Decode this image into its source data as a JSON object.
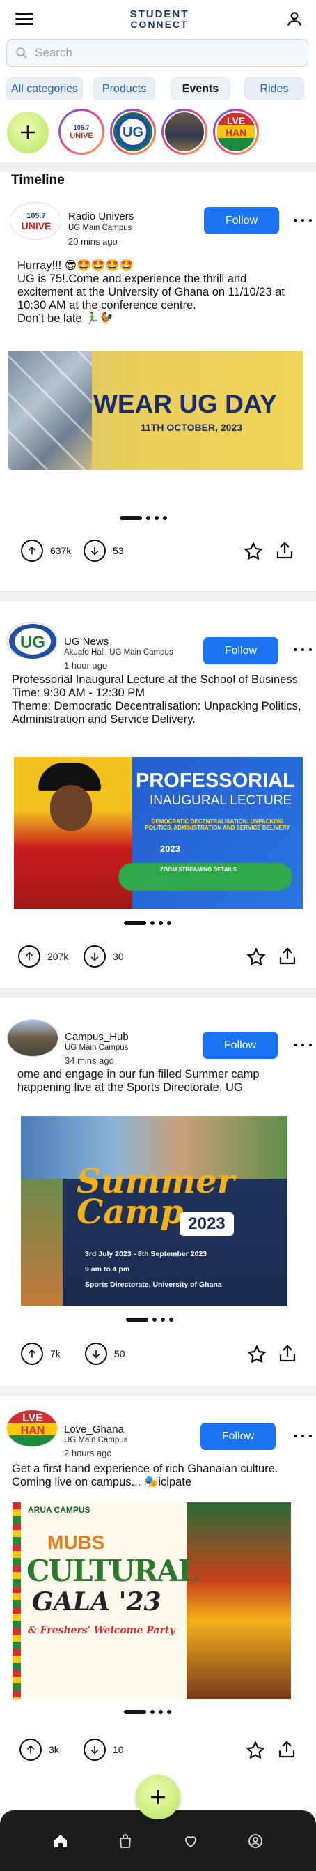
{
  "header": {
    "logo_line1": "STUDENT",
    "logo_line2": "CONNECT"
  },
  "search": {
    "placeholder": "Search",
    "value": ""
  },
  "categories": [
    "All categories",
    "Products",
    "Events",
    "Rides"
  ],
  "selected_category": "Events",
  "stories": {
    "add_label": "add-story",
    "items": [
      "Radio Univers",
      "UG News",
      "Campus_Hub",
      "Love_Ghana"
    ]
  },
  "timeline": {
    "title": "Timeline"
  },
  "posts": [
    {
      "author": "Radio Univers",
      "location": "UG Main Campus",
      "time": "20 mins ago",
      "follow_label": "Follow",
      "text": "Hurray!!! 😎🤩🤩🤩🤩\nUG is 75!.Come and experience the thrill and excitement at the University of Ghana on 11/10/23 at 10:30 AM at the conference centre.\nDon’t be late 🏃‍♂️🐓",
      "image_title": "WEAR UG DAY",
      "image_subtitle": "11TH OCTOBER, 2023",
      "upvotes": "637k",
      "downvotes": "53"
    },
    {
      "author": "UG News",
      "location": "Akuafo Hall, UG Main Campus",
      "time": "1 hour ago",
      "follow_label": "Follow",
      "text": "Professorial Inaugural Lecture at the School of Business\nTime: 9:30 AM - 12:30 PM\nTheme: Democratic Decentralisation: Unpacking Politics, Administration and Service Delivery.",
      "image_title": "PROFESSORIAL",
      "image_subtitle": "INAUGURAL LECTURE",
      "image_line": "DEMOCRATIC DECENTRALISATION: UNPACKING POLITICS, ADMINISTRATION AND SERVICE DELIVERY",
      "image_date": "2023",
      "image_zoom": "ZOOM STREAMING DETAILS",
      "upvotes": "207k",
      "downvotes": "30"
    },
    {
      "author": "Campus_Hub",
      "location": "UG Main Campus",
      "time": "34 mins ago",
      "follow_label": "Follow",
      "text": "ome and engage in our fun filled Summer camp happening live at the Sports Directorate, UG",
      "image_title": "Summer Camp",
      "image_year": "2023",
      "image_l1": "3rd July 2023 - 8th September 2023",
      "image_l2": "9 am to 4 pm",
      "image_l3": "Sports Directorate, University of Ghana",
      "upvotes": "7k",
      "downvotes": "50"
    },
    {
      "author": "Love_Ghana",
      "location": "UG Main Campus",
      "time": "2 hours ago",
      "follow_label": "Follow",
      "text": "Get a first hand experience of rich Ghanaian culture. Coming live on campus... 🎭icipate",
      "image_brand": "MUBS",
      "image_brand_sub": "ARUA CAMPUS",
      "image_title": "CULTURAL",
      "image_title2": "GALA '23",
      "image_sub": "& Freshers' Welcome Party",
      "upvotes": "3k",
      "downvotes": "10"
    }
  ],
  "colors": {
    "follow_bg": "#1a73f0",
    "chip_text": "#1f5fa8",
    "fab": "#c7ee7c",
    "bottom_nav": "#1c1c1c"
  },
  "bottom_nav": [
    "home-icon",
    "shopping-bag-icon",
    "heart-icon",
    "profile-icon"
  ]
}
